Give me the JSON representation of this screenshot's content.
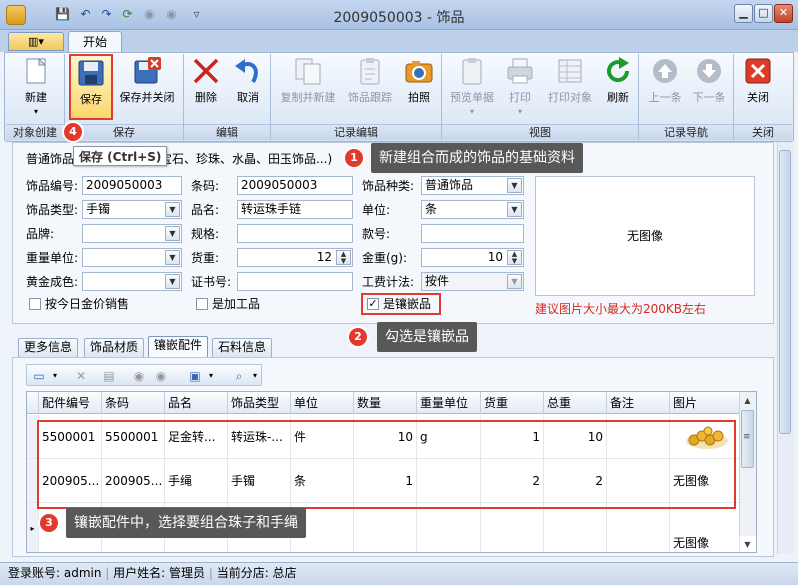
{
  "window": {
    "title": "2009050003 - 饰品",
    "controls": {
      "minimize": "▁",
      "maximize": "□",
      "close": "✕"
    }
  },
  "quick_access": [
    "💾",
    "↶",
    "↷",
    "⟳",
    "◉",
    "◉",
    "▿"
  ],
  "ribbon": {
    "file_menu_label": "▥▾",
    "tab": "开始",
    "groups": [
      {
        "label": "对象创建",
        "buttons": [
          {
            "label": "新建",
            "icon": "new-document-icon",
            "sub": "▾"
          }
        ]
      },
      {
        "label": "保存",
        "buttons": [
          {
            "label": "保存",
            "icon": "floppy-save-icon"
          },
          {
            "label": "保存并关闭",
            "icon": "save-close-icon"
          }
        ]
      },
      {
        "label": "编辑",
        "buttons": [
          {
            "label": "删除",
            "icon": "delete-x-icon"
          },
          {
            "label": "取消",
            "icon": "undo-arrow-icon"
          }
        ]
      },
      {
        "label": "记录编辑",
        "buttons": [
          {
            "label": "复制并新建",
            "icon": "copy-new-icon"
          },
          {
            "label": "饰品跟踪",
            "icon": "clipboard-icon"
          },
          {
            "label": "拍照",
            "icon": "camera-icon"
          }
        ]
      },
      {
        "label": "视图",
        "buttons": [
          {
            "label": "预览单据",
            "icon": "preview-icon",
            "sub": "▾"
          },
          {
            "label": "打印",
            "icon": "printer-icon",
            "sub": "▾"
          },
          {
            "label": "打印对象",
            "icon": "print-object-icon"
          },
          {
            "label": "刷新",
            "icon": "refresh-icon"
          }
        ]
      },
      {
        "label": "记录导航",
        "buttons": [
          {
            "label": "上一条",
            "icon": "arrow-up-icon"
          },
          {
            "label": "下一条",
            "icon": "arrow-down-icon"
          }
        ]
      },
      {
        "label": "关闭",
        "buttons": [
          {
            "label": "关闭",
            "icon": "close-red-icon"
          }
        ]
      }
    ],
    "tooltip": "保存 (Ctrl+S)"
  },
  "form": {
    "top_tab": "普通饰品",
    "top_tab_tail": "宝石、珍珠、水晶、田玉饰品...)",
    "fields": {
      "item_no": {
        "label": "饰品编号:",
        "value": "2009050003"
      },
      "barcode": {
        "label": "条码:",
        "value": "2009050003"
      },
      "kind": {
        "label": "饰品种类:",
        "value": "普通饰品"
      },
      "type": {
        "label": "饰品类型:",
        "value": "手镯"
      },
      "name": {
        "label": "品名:",
        "value": "转运珠手链"
      },
      "unit": {
        "label": "单位:",
        "value": "条"
      },
      "brand": {
        "label": "品牌:",
        "value": ""
      },
      "spec": {
        "label": "规格:",
        "value": ""
      },
      "model": {
        "label": "款号:",
        "value": ""
      },
      "weight_unit": {
        "label": "重量单位:",
        "value": ""
      },
      "weight": {
        "label": "货重:",
        "value": "12"
      },
      "gold_weight": {
        "label": "金重(g):",
        "value": "10"
      },
      "gold_color": {
        "label": "黄金成色:",
        "value": ""
      },
      "cert": {
        "label": "证书号:",
        "value": ""
      },
      "fee_method": {
        "label": "工费计法:",
        "value": "按件"
      }
    },
    "checks": {
      "today_price": "按今日金价销售",
      "processed": "是加工品",
      "inlaid": "是镶嵌品"
    },
    "image_placeholder": "无图像",
    "image_hint": "建议图片大小最大为200KB左右"
  },
  "subtabs": [
    "更多信息",
    "饰品材质",
    "镶嵌配件",
    "石料信息"
  ],
  "grid": {
    "headers": [
      "配件编号",
      "条码",
      "品名",
      "饰品类型",
      "单位",
      "数量",
      "重量单位",
      "货重",
      "总重",
      "备注",
      "图片"
    ],
    "rows": [
      [
        "5500001",
        "5500001",
        "足金转...",
        "转运珠-...",
        "件",
        "10",
        "g",
        "1",
        "10",
        "",
        ""
      ],
      [
        "200905...",
        "200905...",
        "手绳",
        "手镯",
        "条",
        "1",
        "",
        "2",
        "2",
        "",
        "无图像"
      ],
      [
        "",
        "",
        "",
        "",
        "",
        "",
        "",
        "",
        "",
        "",
        "无图像"
      ]
    ]
  },
  "status": {
    "login": "登录账号: admin",
    "user": "用户姓名: 管理员",
    "branch": "当前分店: 总店"
  },
  "callouts": [
    {
      "num": "1",
      "text": "新建组合而成的饰品的基础资料"
    },
    {
      "num": "2",
      "text": "勾选是镶嵌品"
    },
    {
      "num": "3",
      "text": "镶嵌配件中，选择要组合珠子和手绳"
    },
    {
      "num": "4"
    }
  ],
  "colors": {
    "accent_red": "#e23b2f",
    "ribbon_bg": "#d7e4f4",
    "callout_bg": "#585858"
  }
}
